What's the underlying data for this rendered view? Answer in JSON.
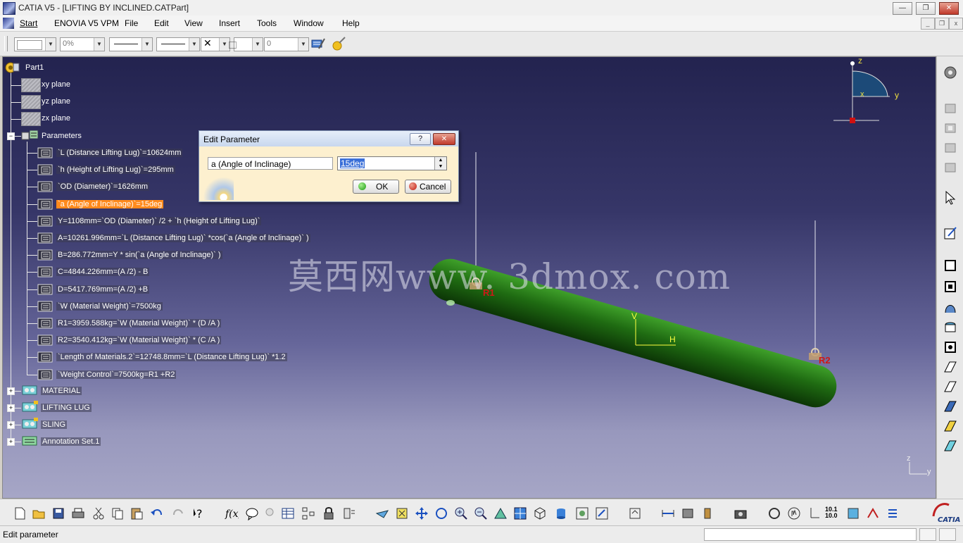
{
  "window": {
    "title": "CATIA V5 - [LIFTING BY INCLINED.CATPart]",
    "min_label": "—",
    "restore_label": "❐",
    "close_label": "✕"
  },
  "menubar": {
    "items": [
      "Start",
      "ENOVIA V5 VPM",
      "File",
      "Edit",
      "View",
      "Insert",
      "Tools",
      "Window",
      "Help"
    ]
  },
  "graphic_properties": {
    "color_value": "",
    "transparency_value": "0%",
    "layer_value": "0"
  },
  "tree": {
    "root": "Part1",
    "planes": [
      "xy plane",
      "yz plane",
      "zx plane"
    ],
    "parameters_label": "Parameters",
    "parameters": [
      "`L (Distance Lifting Lug)`=10624mm",
      "`h (Height of Lifting Lug)`=295mm",
      "`OD (Diameter)`=1626mm",
      "`a (Angle of Inclinage)`=15deg",
      "Y=1108mm=`OD (Diameter)` /2 + `h (Height of Lifting Lug)`",
      "A=10261.996mm=`L (Distance Lifting Lug)` *cos(`a (Angle of Inclinage)` )",
      "B=286.772mm=Y * sin(`a (Angle of Inclinage)` )",
      "C=4844.226mm=(A /2) - B",
      "D=5417.769mm=(A /2) +B",
      "`W (Material Weight)`=7500kg",
      "R1=3959.588kg=`W (Material Weight)` * (D /A )",
      "R2=3540.412kg=`W (Material Weight)` * (C /A )",
      "`Length of Materials.2`=12748.8mm=`L (Distance Lifting Lug)` *1.2",
      "`Weight Control`=7500kg=R1 +R2"
    ],
    "selected_index": 3,
    "sets": [
      "MATERIAL",
      "LIFTING LUG",
      "SLING",
      "Annotation Set.1"
    ]
  },
  "dialog": {
    "title": "Edit Parameter",
    "help_label": "?",
    "close_label": "✕",
    "param_name": "a (Angle of Inclinage)",
    "param_value": "15deg",
    "ok_label": "OK",
    "cancel_label": "Cancel"
  },
  "viewport": {
    "watermark": "莫西网www. 3dmox. com",
    "label_r1": "R1",
    "label_r2": "R2",
    "axis_v": "V",
    "axis_h": "H",
    "compass_z": "z",
    "compass_y": "y",
    "compass_x": "x",
    "mini_z": "z",
    "mini_y": "y",
    "pipe_color": "#1f6b12",
    "background_top": "#23234f",
    "background_bottom": "#a6a6c6"
  },
  "status": {
    "text": "Edit parameter"
  },
  "colors": {
    "selection": "#ff8a1c",
    "dialog_bg": "#fdf0cf"
  }
}
